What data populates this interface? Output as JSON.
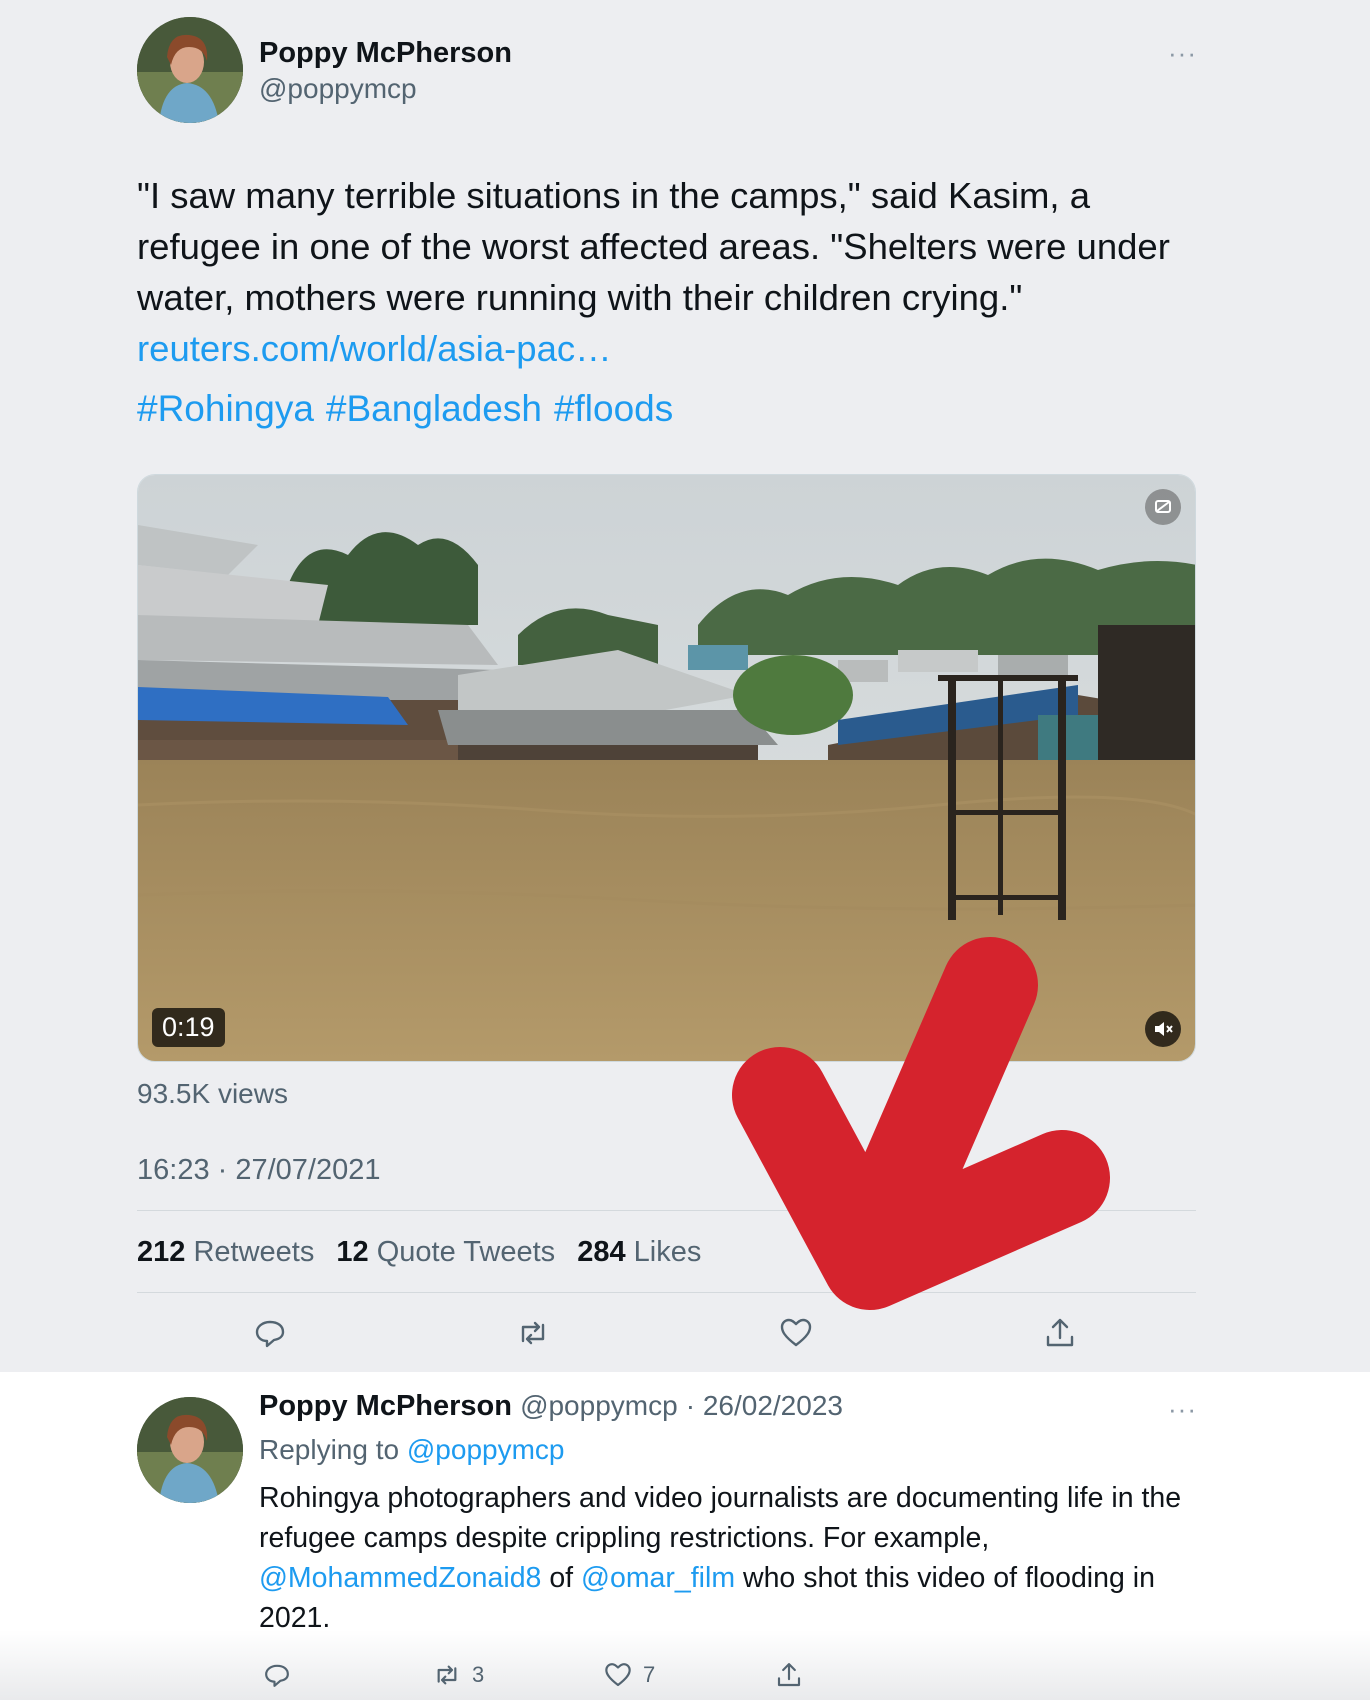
{
  "tweet": {
    "author_name": "Poppy McPherson",
    "author_handle": "@poppymcp",
    "more_label": "···",
    "text": "\"I saw many terrible situations in the camps,\" said Kasim, a refugee in one of the worst affected areas. \"Shelters were under water, mothers were running with their children crying.\"",
    "link": "reuters.com/world/asia-pac…",
    "hashtags": [
      "#Rohingya",
      "#Bangladesh",
      "#floods"
    ],
    "video_duration": "0:19",
    "views": "93.5K views",
    "timestamp": "16:23 · 27/07/2021",
    "stats": {
      "retweets_count": "212",
      "retweets_label": "Retweets",
      "quotes_count": "12",
      "quotes_label": "Quote Tweets",
      "likes_count": "284",
      "likes_label": "Likes"
    }
  },
  "reply": {
    "author_name": "Poppy McPherson",
    "author_handle": "@poppymcp",
    "date": "· 26/02/2023",
    "more_label": "···",
    "replying_prefix": "Replying to",
    "replying_handle": "@poppymcp",
    "text_part1": "Rohingya photographers and video journalists are documenting life in the refugee camps despite crippling restrictions. For example,",
    "mention1": "@MohammedZonaid8",
    "text_of": "of",
    "mention2": "@omar_film",
    "text_part2": "who shot this video of flooding in 2021.",
    "retweet_count": "3",
    "like_count": "7"
  },
  "colors": {
    "link": "#1d9bf0",
    "annotation_arrow": "#d5232d",
    "upper_background": "#edeef1"
  },
  "icons": [
    "reply-icon",
    "retweet-icon",
    "like-icon",
    "share-icon",
    "mute-icon",
    "more-icon"
  ]
}
